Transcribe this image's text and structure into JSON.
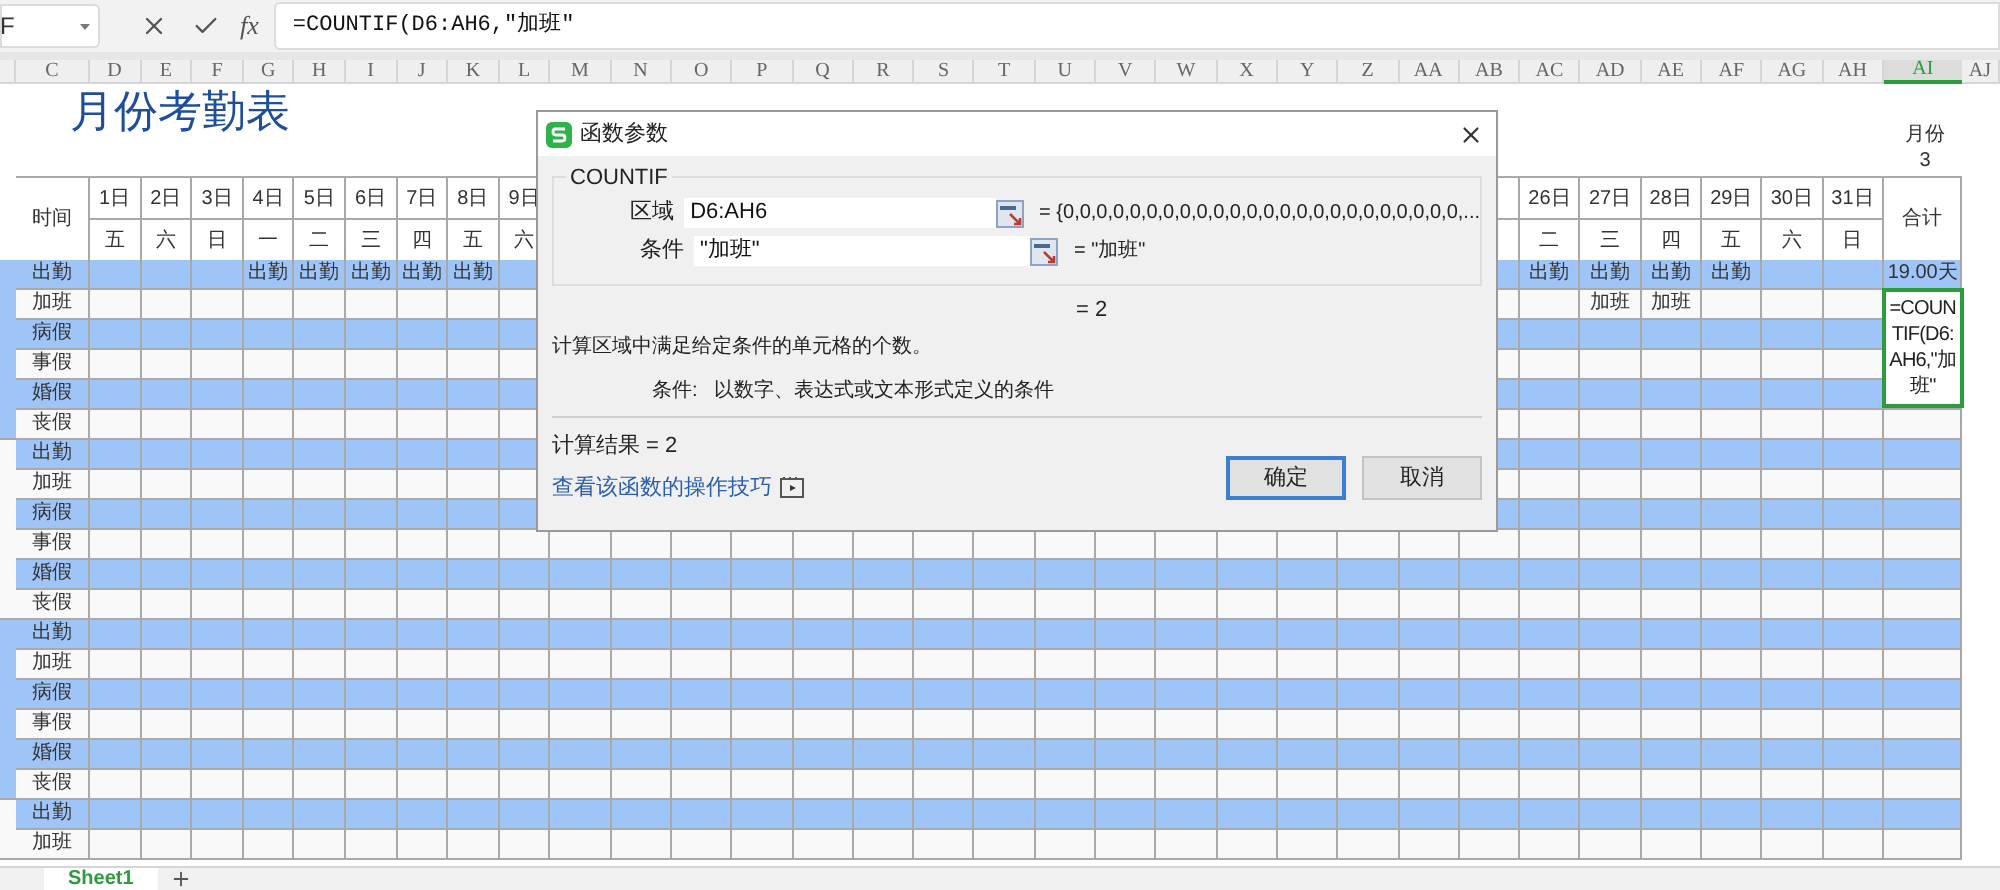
{
  "formula_bar": {
    "name_box": "F",
    "function_label": "fx",
    "formula": "=COUNTIF(D6:AH6,\"加班\""
  },
  "column_headers": [
    {
      "label": "C",
      "selected": false
    },
    {
      "label": "D",
      "selected": false
    },
    {
      "label": "E",
      "selected": false
    },
    {
      "label": "F",
      "selected": false
    },
    {
      "label": "G",
      "selected": false
    },
    {
      "label": "H",
      "selected": false
    },
    {
      "label": "I",
      "selected": false
    },
    {
      "label": "J",
      "selected": false
    },
    {
      "label": "K",
      "selected": false
    },
    {
      "label": "L",
      "selected": false
    },
    {
      "label": "M",
      "selected": false
    },
    {
      "label": "N",
      "selected": false
    },
    {
      "label": "O",
      "selected": false
    },
    {
      "label": "P",
      "selected": false
    },
    {
      "label": "Q",
      "selected": false
    },
    {
      "label": "R",
      "selected": false
    },
    {
      "label": "S",
      "selected": false
    },
    {
      "label": "T",
      "selected": false
    },
    {
      "label": "U",
      "selected": false
    },
    {
      "label": "V",
      "selected": false
    },
    {
      "label": "W",
      "selected": false
    },
    {
      "label": "X",
      "selected": false
    },
    {
      "label": "Y",
      "selected": false
    },
    {
      "label": "Z",
      "selected": false
    },
    {
      "label": "AA",
      "selected": false
    },
    {
      "label": "AB",
      "selected": false
    },
    {
      "label": "AC",
      "selected": false
    },
    {
      "label": "AD",
      "selected": false
    },
    {
      "label": "AE",
      "selected": false
    },
    {
      "label": "AF",
      "selected": false
    },
    {
      "label": "AG",
      "selected": false
    },
    {
      "label": "AH",
      "selected": false
    },
    {
      "label": "AI",
      "selected": true
    },
    {
      "label": "AJ",
      "selected": false
    }
  ],
  "sheet": {
    "title": "月份考勤表",
    "month_label": "月份",
    "month_value": "3",
    "time_header": "时间",
    "total_header": "合计",
    "days_left": [
      {
        "day": "1日",
        "weekday": "五"
      },
      {
        "day": "2日",
        "weekday": "六"
      },
      {
        "day": "3日",
        "weekday": "日"
      },
      {
        "day": "4日",
        "weekday": "一"
      },
      {
        "day": "5日",
        "weekday": "二"
      },
      {
        "day": "6日",
        "weekday": "三"
      },
      {
        "day": "7日",
        "weekday": "四"
      },
      {
        "day": "8日",
        "weekday": "五"
      },
      {
        "day": "9日",
        "weekday": "六"
      }
    ],
    "days_right": [
      {
        "day": "26日",
        "weekday": "二"
      },
      {
        "day": "27日",
        "weekday": "三"
      },
      {
        "day": "28日",
        "weekday": "四"
      },
      {
        "day": "29日",
        "weekday": "五"
      },
      {
        "day": "30日",
        "weekday": "六"
      },
      {
        "day": "31日",
        "weekday": "日"
      }
    ],
    "groups": [
      {
        "highlighted": true,
        "rows": [
          {
            "label": "出勤",
            "highlighted": true,
            "total": {
              "kind": "value",
              "text": "19.00天"
            },
            "cells": [
              null,
              null,
              null,
              "出勤",
              "出勤",
              "出勤",
              "出勤",
              "出勤",
              null,
              null,
              null,
              null,
              null,
              null,
              null,
              null,
              null,
              null,
              null,
              null,
              null,
              null,
              null,
              null,
              null,
              "出勤",
              "出勤",
              "出勤",
              "出勤",
              null,
              null
            ]
          },
          {
            "label": "加班",
            "highlighted": false,
            "total": {
              "kind": "editor",
              "text": "=COUNTIF(D6:AH6,\"加班\""
            },
            "cells": [
              null,
              null,
              null,
              null,
              null,
              null,
              null,
              null,
              null,
              null,
              null,
              null,
              null,
              null,
              null,
              null,
              null,
              null,
              null,
              null,
              null,
              null,
              null,
              null,
              null,
              null,
              "加班",
              "加班",
              null,
              null,
              null
            ]
          },
          {
            "label": "病假",
            "highlighted": true,
            "cells": []
          },
          {
            "label": "事假",
            "highlighted": false,
            "cells": []
          },
          {
            "label": "婚假",
            "highlighted": true,
            "cells": []
          },
          {
            "label": "丧假",
            "highlighted": false,
            "cells": []
          }
        ]
      },
      {
        "highlighted": false,
        "rows": [
          {
            "label": "出勤",
            "highlighted": true,
            "cells": []
          },
          {
            "label": "加班",
            "highlighted": false,
            "cells": []
          },
          {
            "label": "病假",
            "highlighted": true,
            "cells": []
          },
          {
            "label": "事假",
            "highlighted": false,
            "cells": []
          },
          {
            "label": "婚假",
            "highlighted": true,
            "cells": []
          },
          {
            "label": "丧假",
            "highlighted": false,
            "cells": []
          }
        ]
      },
      {
        "highlighted": true,
        "rows": [
          {
            "label": "出勤",
            "highlighted": true,
            "cells": []
          },
          {
            "label": "加班",
            "highlighted": false,
            "cells": []
          },
          {
            "label": "病假",
            "highlighted": true,
            "cells": []
          },
          {
            "label": "事假",
            "highlighted": false,
            "cells": []
          },
          {
            "label": "婚假",
            "highlighted": true,
            "cells": []
          },
          {
            "label": "丧假",
            "highlighted": false,
            "cells": []
          }
        ]
      },
      {
        "highlighted": false,
        "rows": [
          {
            "label": "出勤",
            "highlighted": true,
            "cells": []
          },
          {
            "label": "加班",
            "highlighted": false,
            "cells": []
          }
        ]
      }
    ]
  },
  "dialog": {
    "title": "函数参数",
    "function_name": "COUNTIF",
    "arguments": [
      {
        "label": "区域",
        "value": "D6:AH6",
        "result": "= {0,0,0,0,0,0,0,0,0,0,0,0,0,0,0,0,0,0,0,0,0,0,0,0,..."
      },
      {
        "label": "条件",
        "value": "\"加班\"",
        "result": "= \"加班\""
      }
    ],
    "formula_result": "= 2",
    "description": "计算区域中满足给定条件的单元格的个数。",
    "argument_help_label": "条件:",
    "argument_help": "以数字、表达式或文本形式定义的条件",
    "calc_result": "计算结果 = 2",
    "help_link": "查看该函数的操作技巧",
    "buttons": [
      {
        "label": "确定",
        "default": true
      },
      {
        "label": "取消",
        "default": false
      }
    ]
  },
  "sheet_tabs": [
    {
      "label": "Sheet1",
      "selected": true
    }
  ]
}
